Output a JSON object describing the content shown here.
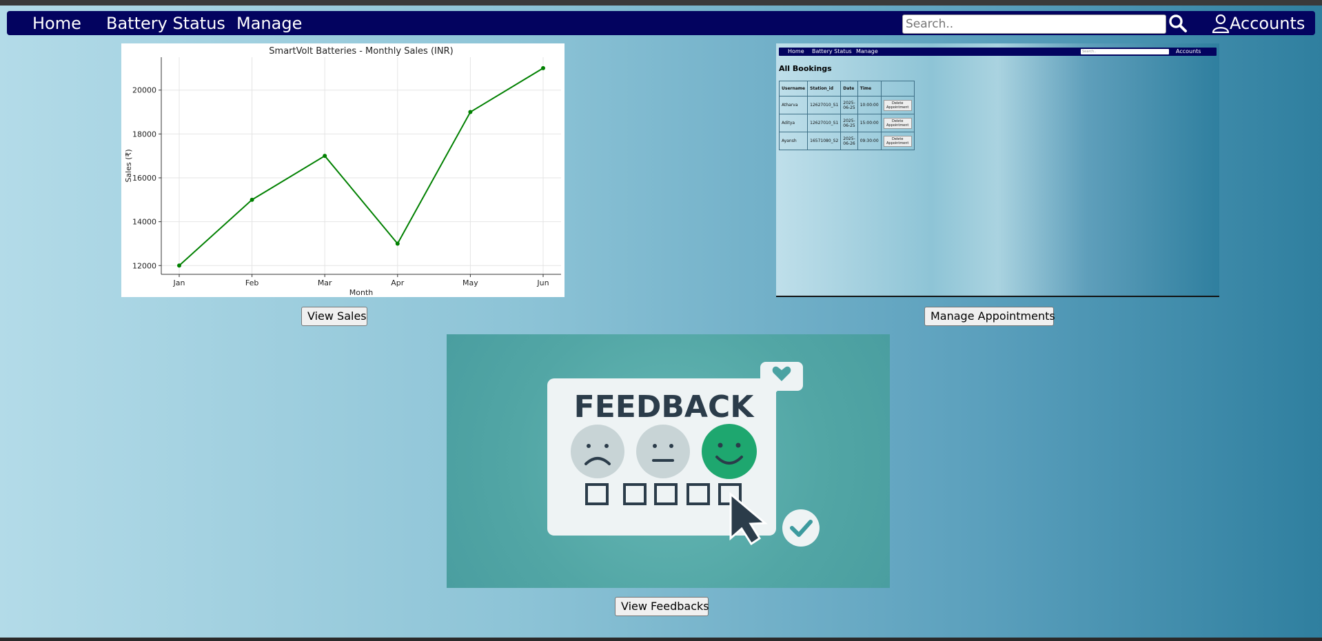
{
  "nav": {
    "links": [
      "Home",
      "Battery Status",
      "Manage"
    ],
    "search_placeholder": "Search..",
    "accounts_label": "Accounts"
  },
  "cards": {
    "sales_button": "View Sales",
    "appointments_button": "Manage Appointments",
    "feedback_button": "View Feedbacks"
  },
  "chart_data": {
    "type": "line",
    "title": "SmartVolt Batteries - Monthly Sales (INR)",
    "xlabel": "Month",
    "ylabel": "Sales (₹)",
    "categories": [
      "Jan",
      "Feb",
      "Mar",
      "Apr",
      "May",
      "Jun"
    ],
    "values": [
      12000,
      15000,
      17000,
      13000,
      19000,
      21000
    ],
    "yticks": [
      12000,
      14000,
      16000,
      18000,
      20000
    ],
    "ylim": [
      11600,
      21500
    ],
    "grid": true,
    "color": "#008000"
  },
  "bookings_preview": {
    "nav_links": [
      "Home",
      "Battery Status",
      "Manage"
    ],
    "search_placeholder": "Search..",
    "accounts_label": "Accounts",
    "title": "All Bookings",
    "columns": [
      "Username",
      "Station_id",
      "Date",
      "Time",
      ""
    ],
    "rows": [
      {
        "username": "Atharva",
        "station": "12627010_S1",
        "date": "2025-06-25",
        "time": "10:00:00",
        "action": "Delete Appointment"
      },
      {
        "username": "Aditya",
        "station": "12627010_S1",
        "date": "2025-06-25",
        "time": "15:00:00",
        "action": "Delete Appointment"
      },
      {
        "username": "Ayansh",
        "station": "16571080_S2",
        "date": "2025-06-26",
        "time": "09:30:00",
        "action": "Delete Appointment"
      }
    ]
  },
  "feedback_image": {
    "heading": "FEEDBACK",
    "colors": {
      "card": "#eef3f4",
      "text": "#2b3c4a",
      "happy": "#1ea76f",
      "neutral": "#c8d4d6"
    }
  }
}
